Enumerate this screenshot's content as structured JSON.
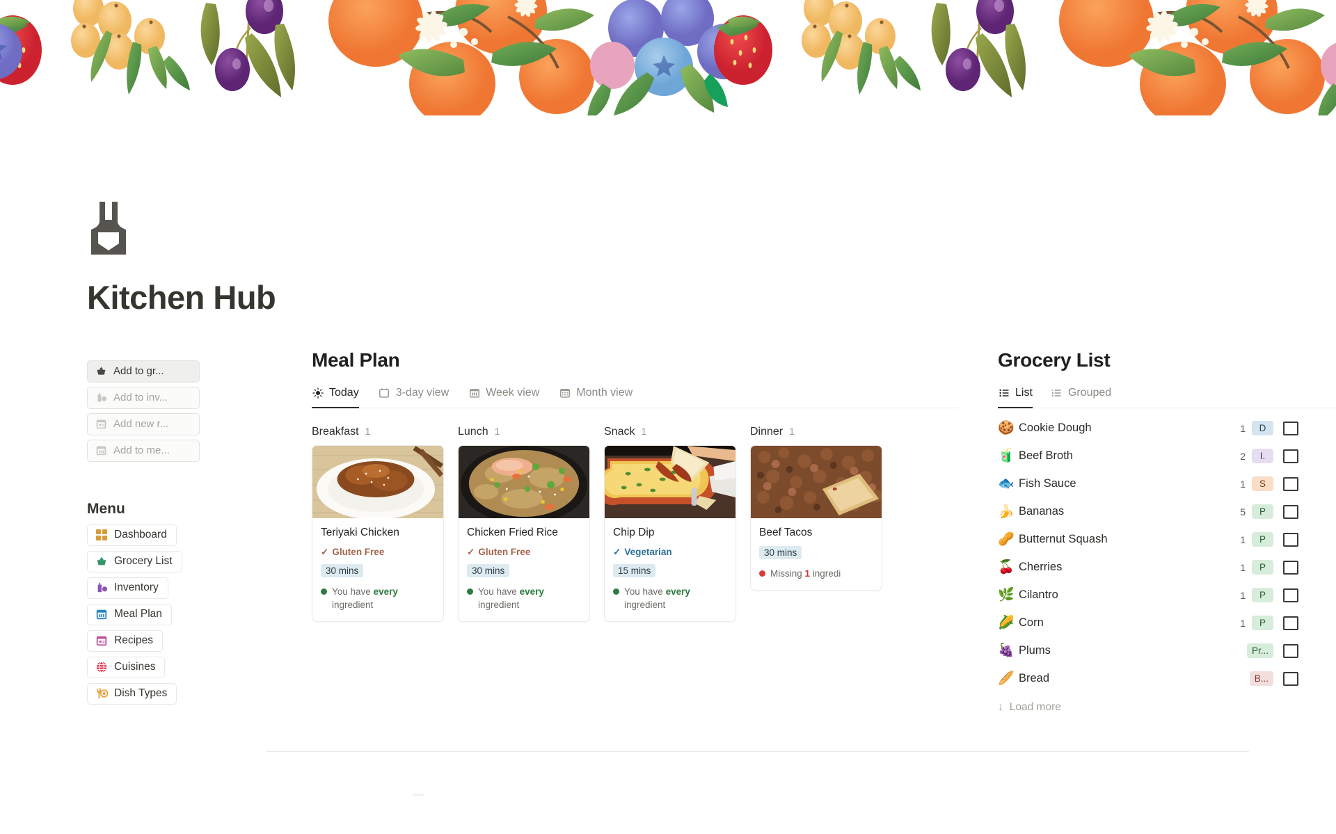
{
  "app": {
    "title": "Kitchen Hub",
    "logo_icon": "apron-icon"
  },
  "banner": {
    "description": "watercolor fruit border with strawberries, blueberries, oranges, olives, plums and leaves"
  },
  "quick_actions": [
    {
      "label": "Add to gr...",
      "icon": "basket-icon",
      "state": "primary"
    },
    {
      "label": "Add to inv...",
      "icon": "pantry-icon",
      "state": "muted"
    },
    {
      "label": "Add new r...",
      "icon": "recipe-card-icon",
      "state": "muted"
    },
    {
      "label": "Add to me...",
      "icon": "calendar-icon",
      "state": "muted"
    }
  ],
  "sidebar": {
    "menu_title": "Menu",
    "items": [
      {
        "label": "Dashboard",
        "icon": "grid-icon",
        "color": "#d99b3a"
      },
      {
        "label": "Grocery List",
        "icon": "basket-icon",
        "color": "#349466"
      },
      {
        "label": "Inventory",
        "icon": "pantry-icon",
        "color": "#8e54b5"
      },
      {
        "label": "Meal Plan",
        "icon": "calendar-icon",
        "color": "#2585bd"
      },
      {
        "label": "Recipes",
        "icon": "recipe-card-icon",
        "color": "#c0529a"
      },
      {
        "label": "Cuisines",
        "icon": "globe-icon",
        "color": "#dc3a52"
      },
      {
        "label": "Dish Types",
        "icon": "fork-plate-icon",
        "color": "#e8a13c"
      }
    ]
  },
  "meal_plan": {
    "title": "Meal Plan",
    "tabs": [
      {
        "label": "Today",
        "icon": "sun-icon",
        "active": true
      },
      {
        "label": "3-day view",
        "icon": "calendar-day-icon",
        "active": false
      },
      {
        "label": "Week view",
        "icon": "calendar-week-icon",
        "active": false
      },
      {
        "label": "Month view",
        "icon": "calendar-month-icon",
        "active": false
      }
    ],
    "slots": [
      {
        "name": "Breakfast",
        "count": "1",
        "recipe": {
          "name": "Teriyaki Chicken",
          "diet": "Gluten Free",
          "diet_type": "gf",
          "time": "30 mins",
          "status_prefix": "You have ",
          "status_strong": "every",
          "status_suffix": " ingredient",
          "status_type": "ok",
          "image": "teriyaki-chicken-photo"
        }
      },
      {
        "name": "Lunch",
        "count": "1",
        "recipe": {
          "name": "Chicken Fried Rice",
          "diet": "Gluten Free",
          "diet_type": "gf",
          "time": "30 mins",
          "status_prefix": "You have ",
          "status_strong": "every",
          "status_suffix": " ingredient",
          "status_type": "ok",
          "image": "chicken-fried-rice-photo"
        }
      },
      {
        "name": "Snack",
        "count": "1",
        "recipe": {
          "name": "Chip Dip",
          "diet": "Vegetarian",
          "diet_type": "veg",
          "time": "15 mins",
          "status_prefix": "You have ",
          "status_strong": "every",
          "status_suffix": " ingredient",
          "status_type": "ok",
          "image": "chip-dip-photo"
        }
      },
      {
        "name": "Dinner",
        "count": "1",
        "recipe": {
          "name": "Beef Tacos",
          "diet": "",
          "diet_type": "none",
          "time": "30 mins",
          "status_prefix": "Missing ",
          "status_strong": "1",
          "status_suffix": " ingredi",
          "status_type": "bad",
          "image": "beef-tacos-photo"
        }
      }
    ]
  },
  "grocery": {
    "title": "Grocery List",
    "tabs": [
      {
        "label": "List",
        "icon": "list-icon",
        "active": true
      },
      {
        "label": "Grouped",
        "icon": "grouped-list-icon",
        "active": false
      }
    ],
    "load_more": "Load more",
    "items": [
      {
        "emoji": "🍪",
        "name": "Cookie Dough",
        "qty": "1",
        "badge": "D",
        "badge_color": "blue"
      },
      {
        "emoji": "🧃",
        "name": "Beef Broth",
        "qty": "2",
        "badge": "I.",
        "badge_color": "purple"
      },
      {
        "emoji": "🐟",
        "name": "Fish Sauce",
        "qty": "1",
        "badge": "S",
        "badge_color": "orange"
      },
      {
        "emoji": "🍌",
        "name": "Bananas",
        "qty": "5",
        "badge": "P",
        "badge_color": "green"
      },
      {
        "emoji": "🥜",
        "name": "Butternut Squash",
        "qty": "1",
        "badge": "P",
        "badge_color": "green"
      },
      {
        "emoji": "🍒",
        "name": "Cherries",
        "qty": "1",
        "badge": "P",
        "badge_color": "green"
      },
      {
        "emoji": "🌿",
        "name": "Cilantro",
        "qty": "1",
        "badge": "P",
        "badge_color": "green"
      },
      {
        "emoji": "🌽",
        "name": "Corn",
        "qty": "1",
        "badge": "P",
        "badge_color": "green"
      },
      {
        "emoji": "🍇",
        "name": "Plums",
        "qty": "",
        "badge": "Pr...",
        "badge_color": "green"
      },
      {
        "emoji": "🥖",
        "name": "Bread",
        "qty": "",
        "badge": "B...",
        "badge_color": "pink"
      }
    ]
  },
  "colors": {
    "accent_time_chip": "#ddeaf0",
    "ok_green": "#2f7a41",
    "missing_red": "#d93a36",
    "gluten_free": "#a2644b",
    "vegetarian": "#2f6f97"
  }
}
